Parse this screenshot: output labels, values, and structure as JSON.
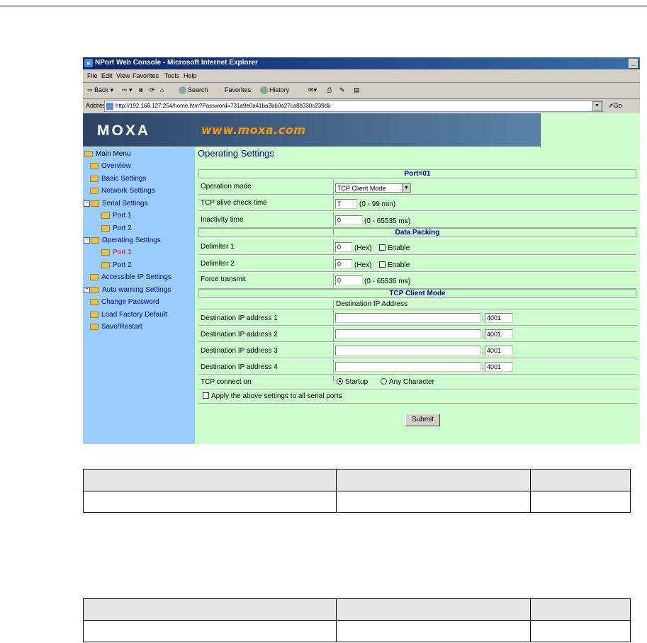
{
  "browser": {
    "title": "NPort Web Console - Microsoft Internet Explorer",
    "menu": [
      "File",
      "Edit",
      "View",
      "Favorites",
      "Tools",
      "Help"
    ],
    "toolbar": {
      "back": "Back",
      "search": "Search",
      "favorites": "Favorites",
      "history": "History"
    },
    "address_label": "Address",
    "address_url": "http://192.168.127.254/home.htm?Password=731a9e0a41ba3bb0a27ca8b330c239db",
    "go_label": "Go"
  },
  "banner": {
    "logo": "MOXA",
    "url": "www.moxa.com"
  },
  "nav": {
    "main_menu": "Main Menu",
    "items": [
      "Overview",
      "Basic Settings",
      "Network Settings",
      "Serial Settings",
      "Port 1",
      "Port 2",
      "Operating Settings",
      "Port 1",
      "Port 2",
      "Accessible IP Settings",
      "Auto warning Settings",
      "Change Password",
      "Load Factory Default",
      "Save/Restart"
    ]
  },
  "form": {
    "page_title": "Operating Settings",
    "port_header": "Port=01",
    "operation_mode_label": "Operation mode",
    "operation_mode_value": "TCP Client Mode",
    "tcp_alive_label": "TCP alive check time",
    "tcp_alive_value": "7",
    "tcp_alive_range": "(0 - 99 min)",
    "inactivity_label": "Inactivity time",
    "inactivity_value": "0",
    "inactivity_range": "(0 - 65535 ms)",
    "data_packing_header": "Data Packing",
    "delimiter1_label": "Delimiter 1",
    "delimiter1_value": "0",
    "delimiter2_label": "Delimiter 2",
    "delimiter2_value": "0",
    "hex_label": "(Hex)",
    "enable_label": "Enable",
    "force_transmit_label": "Force transmit",
    "force_transmit_value": "0",
    "force_transmit_range": "(0 - 65535 ms)",
    "tcp_client_header": "TCP Client Mode",
    "dest_ip_subheader": "Destination IP Address",
    "dest_rows": [
      {
        "label": "Destination IP address 1",
        "ip": "",
        "port": "4001"
      },
      {
        "label": "Destination IP address 2",
        "ip": "",
        "port": "4001"
      },
      {
        "label": "Destination IP address 3",
        "ip": "",
        "port": "4001"
      },
      {
        "label": "Destination IP address 4",
        "ip": "",
        "port": "4001"
      }
    ],
    "colon": ":",
    "tcp_connect_label": "TCP connect on",
    "startup_label": "Startup",
    "any_char_label": "Any Character",
    "apply_all_label": "Apply the above settings to all serial ports",
    "submit_label": "Submit"
  }
}
